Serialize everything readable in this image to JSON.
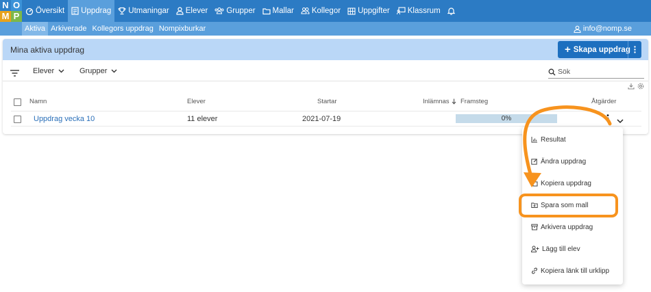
{
  "logo": {
    "letters": [
      "N",
      "O",
      "M",
      "P"
    ]
  },
  "nav": {
    "items": [
      {
        "label": "Översikt",
        "icon": "speedometer-icon",
        "active": false
      },
      {
        "label": "Uppdrag",
        "icon": "document-icon",
        "active": true
      },
      {
        "label": "Utmaningar",
        "icon": "trophy-icon",
        "active": false
      },
      {
        "label": "Elever",
        "icon": "person-icon",
        "active": false
      },
      {
        "label": "Grupper",
        "icon": "group-icon",
        "active": false
      },
      {
        "label": "Mallar",
        "icon": "folder-icon",
        "active": false
      },
      {
        "label": "Kollegor",
        "icon": "people-icon",
        "active": false
      },
      {
        "label": "Uppgifter",
        "icon": "grid-icon",
        "active": false
      },
      {
        "label": "Klassrum",
        "icon": "classroom-icon",
        "active": false
      }
    ],
    "bell_icon": "bell-icon"
  },
  "subnav": {
    "items": [
      {
        "label": "Aktiva",
        "active": true
      },
      {
        "label": "Arkiverade",
        "active": false
      },
      {
        "label": "Kollegors uppdrag",
        "active": false
      },
      {
        "label": "Nompixburkar",
        "active": false
      }
    ],
    "user_email": "info@nomp.se"
  },
  "card": {
    "title": "Mina aktiva uppdrag",
    "create_button": "Skapa uppdrag"
  },
  "filters": {
    "students": "Elever",
    "groups": "Grupper",
    "search_placeholder": "Sök"
  },
  "table": {
    "headers": {
      "name": "Namn",
      "students": "Elever",
      "starts": "Startar",
      "submitted": "Inlämnas",
      "progress": "Framsteg",
      "actions": "Åtgärder"
    },
    "rows": [
      {
        "name": "Uppdrag vecka 10",
        "students": "11 elever",
        "starts": "2021-07-19",
        "progress_label": "0%",
        "progress": 0
      }
    ]
  },
  "menu": {
    "items": [
      {
        "label": "Resultat",
        "icon": "chart-icon"
      },
      {
        "label": "Ändra uppdrag",
        "icon": "edit-icon"
      },
      {
        "label": "Kopiera uppdrag",
        "icon": "copy-icon"
      },
      {
        "label": "Spara som mall",
        "icon": "folder-save-icon",
        "highlighted": true
      },
      {
        "label": "Arkivera uppdrag",
        "icon": "archive-icon"
      },
      {
        "label": "Lägg till elev",
        "icon": "person-add-icon"
      },
      {
        "label": "Kopiera länk till urklipp",
        "icon": "link-icon"
      }
    ]
  },
  "colors": {
    "topbar": "#2c7bc4",
    "subbar": "#5a9fdc",
    "card_header": "#bad7f7",
    "primary_button": "#1d6fbf",
    "annotation": "#f7931e"
  }
}
